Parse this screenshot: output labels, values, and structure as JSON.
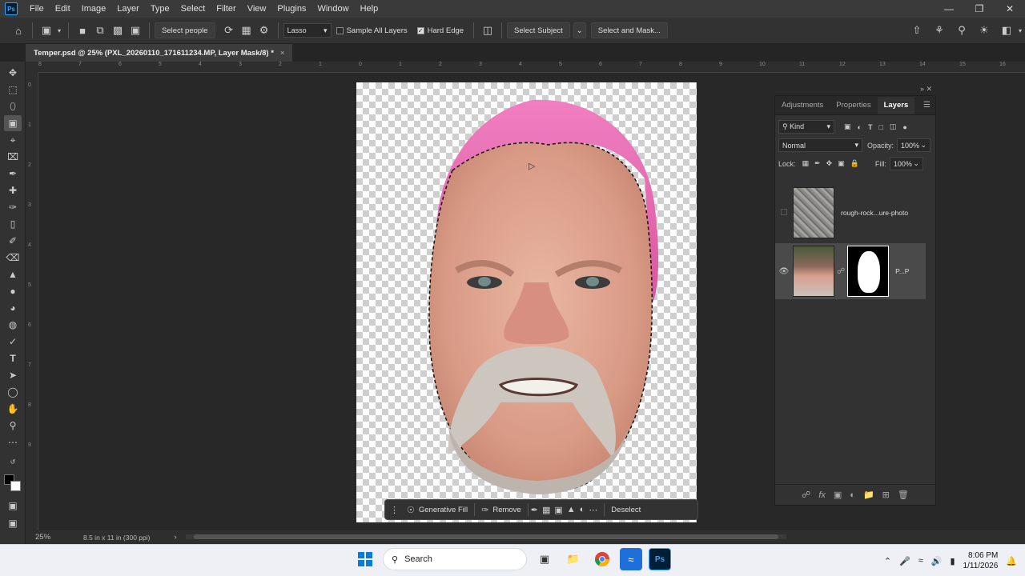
{
  "menubar": {
    "logo": "Ps",
    "items": [
      "File",
      "Edit",
      "Image",
      "Layer",
      "Type",
      "Select",
      "Filter",
      "View",
      "Plugins",
      "Window",
      "Help"
    ]
  },
  "options": {
    "select_people": "Select people",
    "mode": "Lasso",
    "sample_all_layers": "Sample All Layers",
    "hard_edge": "Hard Edge",
    "select_subject": "Select Subject",
    "select_and_mask": "Select and Mask..."
  },
  "document": {
    "tab_title": "Temper.psd @ 25% (PXL_20260110_171611234.MP, Layer Mask/8) *",
    "close": "×"
  },
  "ruler": {
    "top_ticks": [
      "8",
      "7",
      "6",
      "5",
      "4",
      "3",
      "2",
      "1",
      "0",
      "1",
      "2",
      "3",
      "4",
      "5",
      "6",
      "7",
      "8",
      "9",
      "10",
      "11",
      "12",
      "13",
      "14",
      "15",
      "16"
    ],
    "left_ticks": [
      "0",
      "1",
      "2",
      "3",
      "4",
      "5",
      "6",
      "7",
      "8",
      "9"
    ]
  },
  "contextbar": {
    "generative_fill": "Generative Fill",
    "remove": "Remove",
    "deselect": "Deselect"
  },
  "status": {
    "zoom": "25%",
    "doc_size": "8.5 in x 11 in (300 ppi)"
  },
  "panel": {
    "tabs": [
      "Adjustments",
      "Properties",
      "Layers"
    ],
    "filter_kind": "Kind",
    "blend_mode": "Normal",
    "opacity_label": "Opacity:",
    "opacity_value": "100%",
    "lock_label": "Lock:",
    "fill_label": "Fill:",
    "fill_value": "100%",
    "layers": [
      {
        "name": "rough-rock...ure-photo",
        "visible": false,
        "selected": false
      },
      {
        "name": "P...P",
        "visible": true,
        "selected": true
      }
    ]
  },
  "taskbar": {
    "search": "Search",
    "time": "8:06 PM",
    "date": "1/11/2026"
  },
  "colors": {
    "hair": "#e573b8",
    "skin": "#dfa893",
    "accent": "#31a8ff"
  }
}
